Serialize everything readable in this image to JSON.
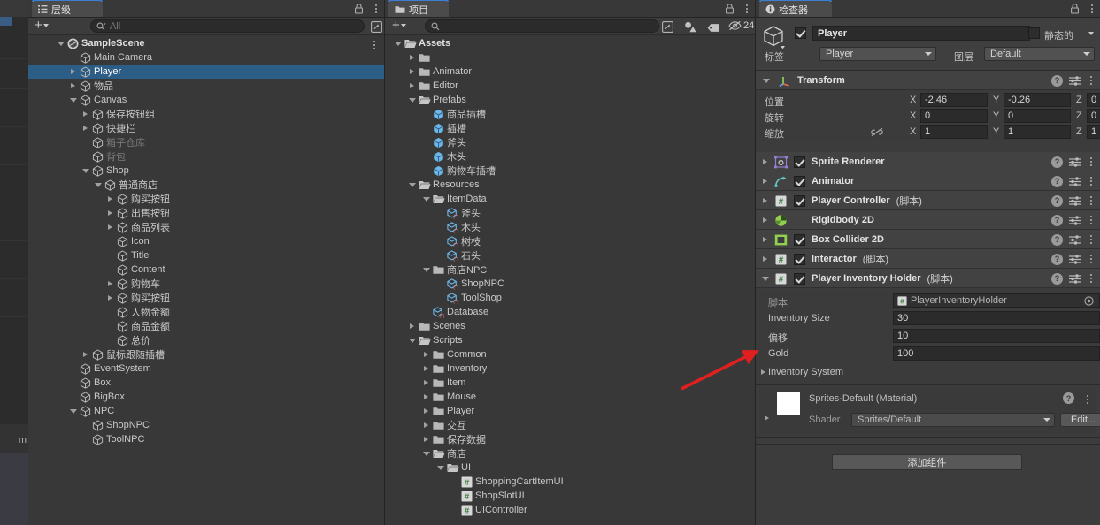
{
  "hierarchy": {
    "tab_label": "层级",
    "tab_icon": "hierarchy-icon",
    "search_placeholder": "All",
    "search_value": "",
    "add_label": "+",
    "items": [
      {
        "label": "SampleScene",
        "depth": 0,
        "twist": "down",
        "icon": "unity-scene-icon",
        "bold": true,
        "selected": false,
        "dim": false
      },
      {
        "label": "Main Camera",
        "depth": 1,
        "twist": "none",
        "icon": "gameobject-icon",
        "bold": false,
        "selected": false,
        "dim": false
      },
      {
        "label": "Player",
        "depth": 1,
        "twist": "right",
        "icon": "gameobject-icon",
        "bold": false,
        "selected": true,
        "dim": false
      },
      {
        "label": "物品",
        "depth": 1,
        "twist": "right",
        "icon": "gameobject-icon",
        "bold": false,
        "selected": false,
        "dim": false
      },
      {
        "label": "Canvas",
        "depth": 1,
        "twist": "down",
        "icon": "gameobject-icon",
        "bold": false,
        "selected": false,
        "dim": false
      },
      {
        "label": "保存按钮组",
        "depth": 2,
        "twist": "right",
        "icon": "gameobject-icon",
        "bold": false,
        "selected": false,
        "dim": false
      },
      {
        "label": "快捷栏",
        "depth": 2,
        "twist": "right",
        "icon": "gameobject-icon",
        "bold": false,
        "selected": false,
        "dim": false
      },
      {
        "label": "箱子仓库",
        "depth": 2,
        "twist": "none",
        "icon": "gameobject-icon",
        "bold": false,
        "selected": false,
        "dim": true
      },
      {
        "label": "背包",
        "depth": 2,
        "twist": "none",
        "icon": "gameobject-icon",
        "bold": false,
        "selected": false,
        "dim": true
      },
      {
        "label": "Shop",
        "depth": 2,
        "twist": "down",
        "icon": "gameobject-icon",
        "bold": false,
        "selected": false,
        "dim": false
      },
      {
        "label": "普通商店",
        "depth": 3,
        "twist": "down",
        "icon": "gameobject-icon",
        "bold": false,
        "selected": false,
        "dim": false
      },
      {
        "label": "购买按钮",
        "depth": 4,
        "twist": "right",
        "icon": "gameobject-icon",
        "bold": false,
        "selected": false,
        "dim": false
      },
      {
        "label": "出售按钮",
        "depth": 4,
        "twist": "right",
        "icon": "gameobject-icon",
        "bold": false,
        "selected": false,
        "dim": false
      },
      {
        "label": "商品列表",
        "depth": 4,
        "twist": "right",
        "icon": "gameobject-icon",
        "bold": false,
        "selected": false,
        "dim": false
      },
      {
        "label": "Icon",
        "depth": 4,
        "twist": "none",
        "icon": "gameobject-icon",
        "bold": false,
        "selected": false,
        "dim": false
      },
      {
        "label": "Title",
        "depth": 4,
        "twist": "none",
        "icon": "gameobject-icon",
        "bold": false,
        "selected": false,
        "dim": false
      },
      {
        "label": "Content",
        "depth": 4,
        "twist": "none",
        "icon": "gameobject-icon",
        "bold": false,
        "selected": false,
        "dim": false
      },
      {
        "label": "购物车",
        "depth": 4,
        "twist": "right",
        "icon": "gameobject-icon",
        "bold": false,
        "selected": false,
        "dim": false
      },
      {
        "label": "购买按钮",
        "depth": 4,
        "twist": "right",
        "icon": "gameobject-icon",
        "bold": false,
        "selected": false,
        "dim": false
      },
      {
        "label": "人物金额",
        "depth": 4,
        "twist": "none",
        "icon": "gameobject-icon",
        "bold": false,
        "selected": false,
        "dim": false
      },
      {
        "label": "商品金额",
        "depth": 4,
        "twist": "none",
        "icon": "gameobject-icon",
        "bold": false,
        "selected": false,
        "dim": false
      },
      {
        "label": "总价",
        "depth": 4,
        "twist": "none",
        "icon": "gameobject-icon",
        "bold": false,
        "selected": false,
        "dim": false
      },
      {
        "label": "鼠标跟随插槽",
        "depth": 2,
        "twist": "right",
        "icon": "gameobject-icon",
        "bold": false,
        "selected": false,
        "dim": false
      },
      {
        "label": "EventSystem",
        "depth": 1,
        "twist": "none",
        "icon": "gameobject-icon",
        "bold": false,
        "selected": false,
        "dim": false
      },
      {
        "label": "Box",
        "depth": 1,
        "twist": "none",
        "icon": "gameobject-icon",
        "bold": false,
        "selected": false,
        "dim": false
      },
      {
        "label": "BigBox",
        "depth": 1,
        "twist": "none",
        "icon": "gameobject-icon",
        "bold": false,
        "selected": false,
        "dim": false
      },
      {
        "label": "NPC",
        "depth": 1,
        "twist": "down",
        "icon": "gameobject-icon",
        "bold": false,
        "selected": false,
        "dim": false
      },
      {
        "label": "ShopNPC",
        "depth": 2,
        "twist": "none",
        "icon": "gameobject-icon",
        "bold": false,
        "selected": false,
        "dim": false
      },
      {
        "label": "ToolNPC",
        "depth": 2,
        "twist": "none",
        "icon": "gameobject-icon",
        "bold": false,
        "selected": false,
        "dim": false
      }
    ]
  },
  "project": {
    "tab_label": "项目",
    "tab_icon": "folder-icon",
    "search_placeholder": "",
    "search_value": "",
    "add_label": "+",
    "hidden_count": "24",
    "items": [
      {
        "label": "Assets",
        "depth": 0,
        "twist": "down",
        "icon": "folder-open-icon",
        "bold": true
      },
      {
        "label": "",
        "depth": 1,
        "twist": "right",
        "icon": "folder-icon",
        "bold": false
      },
      {
        "label": "Animator",
        "depth": 1,
        "twist": "right",
        "icon": "folder-icon",
        "bold": false
      },
      {
        "label": "Editor",
        "depth": 1,
        "twist": "right",
        "icon": "folder-icon",
        "bold": false
      },
      {
        "label": "Prefabs",
        "depth": 1,
        "twist": "down",
        "icon": "folder-open-icon",
        "bold": false
      },
      {
        "label": "商品插槽",
        "depth": 2,
        "twist": "none",
        "icon": "prefab-icon",
        "bold": false
      },
      {
        "label": "插槽",
        "depth": 2,
        "twist": "none",
        "icon": "prefab-icon",
        "bold": false
      },
      {
        "label": "斧头",
        "depth": 2,
        "twist": "none",
        "icon": "prefab-icon",
        "bold": false
      },
      {
        "label": "木头",
        "depth": 2,
        "twist": "none",
        "icon": "prefab-icon",
        "bold": false
      },
      {
        "label": "购物车插槽",
        "depth": 2,
        "twist": "none",
        "icon": "prefab-icon",
        "bold": false
      },
      {
        "label": "Resources",
        "depth": 1,
        "twist": "down",
        "icon": "folder-open-icon",
        "bold": false
      },
      {
        "label": "ItemData",
        "depth": 2,
        "twist": "down",
        "icon": "folder-open-icon",
        "bold": false
      },
      {
        "label": "斧头",
        "depth": 3,
        "twist": "none",
        "icon": "scriptable-object-icon",
        "bold": false
      },
      {
        "label": "木头",
        "depth": 3,
        "twist": "none",
        "icon": "scriptable-object-icon",
        "bold": false
      },
      {
        "label": "树枝",
        "depth": 3,
        "twist": "none",
        "icon": "scriptable-object-icon",
        "bold": false
      },
      {
        "label": "石头",
        "depth": 3,
        "twist": "none",
        "icon": "scriptable-object-icon",
        "bold": false
      },
      {
        "label": "商店NPC",
        "depth": 2,
        "twist": "down",
        "icon": "folder-icon",
        "bold": false
      },
      {
        "label": "ShopNPC",
        "depth": 3,
        "twist": "none",
        "icon": "scriptable-object-icon",
        "bold": false
      },
      {
        "label": "ToolShop",
        "depth": 3,
        "twist": "none",
        "icon": "scriptable-object-icon",
        "bold": false
      },
      {
        "label": "Database",
        "depth": 2,
        "twist": "none",
        "icon": "scriptable-object-icon",
        "bold": false
      },
      {
        "label": "Scenes",
        "depth": 1,
        "twist": "right",
        "icon": "folder-icon",
        "bold": false
      },
      {
        "label": "Scripts",
        "depth": 1,
        "twist": "down",
        "icon": "folder-open-icon",
        "bold": false
      },
      {
        "label": "Common",
        "depth": 2,
        "twist": "right",
        "icon": "folder-icon",
        "bold": false
      },
      {
        "label": "Inventory",
        "depth": 2,
        "twist": "right",
        "icon": "folder-icon",
        "bold": false
      },
      {
        "label": "Item",
        "depth": 2,
        "twist": "right",
        "icon": "folder-icon",
        "bold": false
      },
      {
        "label": "Mouse",
        "depth": 2,
        "twist": "right",
        "icon": "folder-icon",
        "bold": false
      },
      {
        "label": "Player",
        "depth": 2,
        "twist": "right",
        "icon": "folder-icon",
        "bold": false
      },
      {
        "label": "交互",
        "depth": 2,
        "twist": "right",
        "icon": "folder-icon",
        "bold": false
      },
      {
        "label": "保存数据",
        "depth": 2,
        "twist": "right",
        "icon": "folder-icon",
        "bold": false
      },
      {
        "label": "商店",
        "depth": 2,
        "twist": "down",
        "icon": "folder-open-icon",
        "bold": false
      },
      {
        "label": "UI",
        "depth": 3,
        "twist": "down",
        "icon": "folder-open-icon",
        "bold": false
      },
      {
        "label": "ShoppingCartItemUI",
        "depth": 4,
        "twist": "none",
        "icon": "csharp-script-icon",
        "bold": false
      },
      {
        "label": "ShopSlotUI",
        "depth": 4,
        "twist": "none",
        "icon": "csharp-script-icon",
        "bold": false
      },
      {
        "label": "UIController",
        "depth": 4,
        "twist": "none",
        "icon": "csharp-script-icon",
        "bold": false
      }
    ]
  },
  "inspector": {
    "tab_label": "检查器",
    "tab_icon": "info-icon",
    "object": {
      "enabled": true,
      "name": "Player",
      "static_label": "静态的",
      "static_checked": false,
      "tag_label": "标签",
      "tag_value": "Player",
      "layer_label": "图层",
      "layer_value": "Default"
    },
    "transform": {
      "title": "Transform",
      "icon": "transform-icon",
      "rows": [
        {
          "label": "位置",
          "x": "-2.46",
          "y": "-0.26",
          "z": "0",
          "has_link": false
        },
        {
          "label": "旋转",
          "x": "0",
          "y": "0",
          "z": "0",
          "has_link": false
        },
        {
          "label": "缩放",
          "x": "1",
          "y": "1",
          "z": "1",
          "has_link": true
        }
      ],
      "axis_x": "X",
      "axis_y": "Y",
      "axis_z": "Z"
    },
    "components": [
      {
        "title": "Sprite Renderer",
        "sub": "",
        "icon": "sprite-renderer-icon",
        "has_checkbox": true,
        "checked": true,
        "expanded": false
      },
      {
        "title": "Animator",
        "sub": "",
        "icon": "animator-icon",
        "has_checkbox": true,
        "checked": true,
        "expanded": false
      },
      {
        "title": "Player Controller",
        "sub": "(脚本)",
        "icon": "csharp-script-icon",
        "has_checkbox": true,
        "checked": true,
        "expanded": false
      },
      {
        "title": "Rigidbody 2D",
        "sub": "",
        "icon": "rigidbody2d-icon",
        "has_checkbox": false,
        "checked": false,
        "expanded": false
      },
      {
        "title": "Box Collider 2D",
        "sub": "",
        "icon": "boxcollider2d-icon",
        "has_checkbox": true,
        "checked": true,
        "expanded": false
      },
      {
        "title": "Interactor",
        "sub": "(脚本)",
        "icon": "csharp-script-icon",
        "has_checkbox": true,
        "checked": true,
        "expanded": false
      },
      {
        "title": "Player Inventory Holder",
        "sub": "(脚本)",
        "icon": "csharp-script-icon",
        "has_checkbox": true,
        "checked": true,
        "expanded": true
      }
    ],
    "inventory_holder": {
      "script_label": "脚本",
      "script_value": "PlayerInventoryHolder",
      "script_icon": "csharp-script-icon",
      "fields": [
        {
          "label": "Inventory Size",
          "value": "30"
        },
        {
          "label": "偏移",
          "value": "10"
        },
        {
          "label": "Gold",
          "value": "100"
        }
      ],
      "foldout_label": "Inventory System"
    },
    "material": {
      "title": "Sprites-Default (Material)",
      "shader_label": "Shader",
      "shader_value": "Sprites/Default",
      "edit_label": "Edit...",
      "swatch_color": "#ffffff"
    },
    "add_component_label": "添加组件"
  },
  "annotation": {
    "arrow_color": "#e02020",
    "arrow_name": "red-pointer-arrow"
  }
}
